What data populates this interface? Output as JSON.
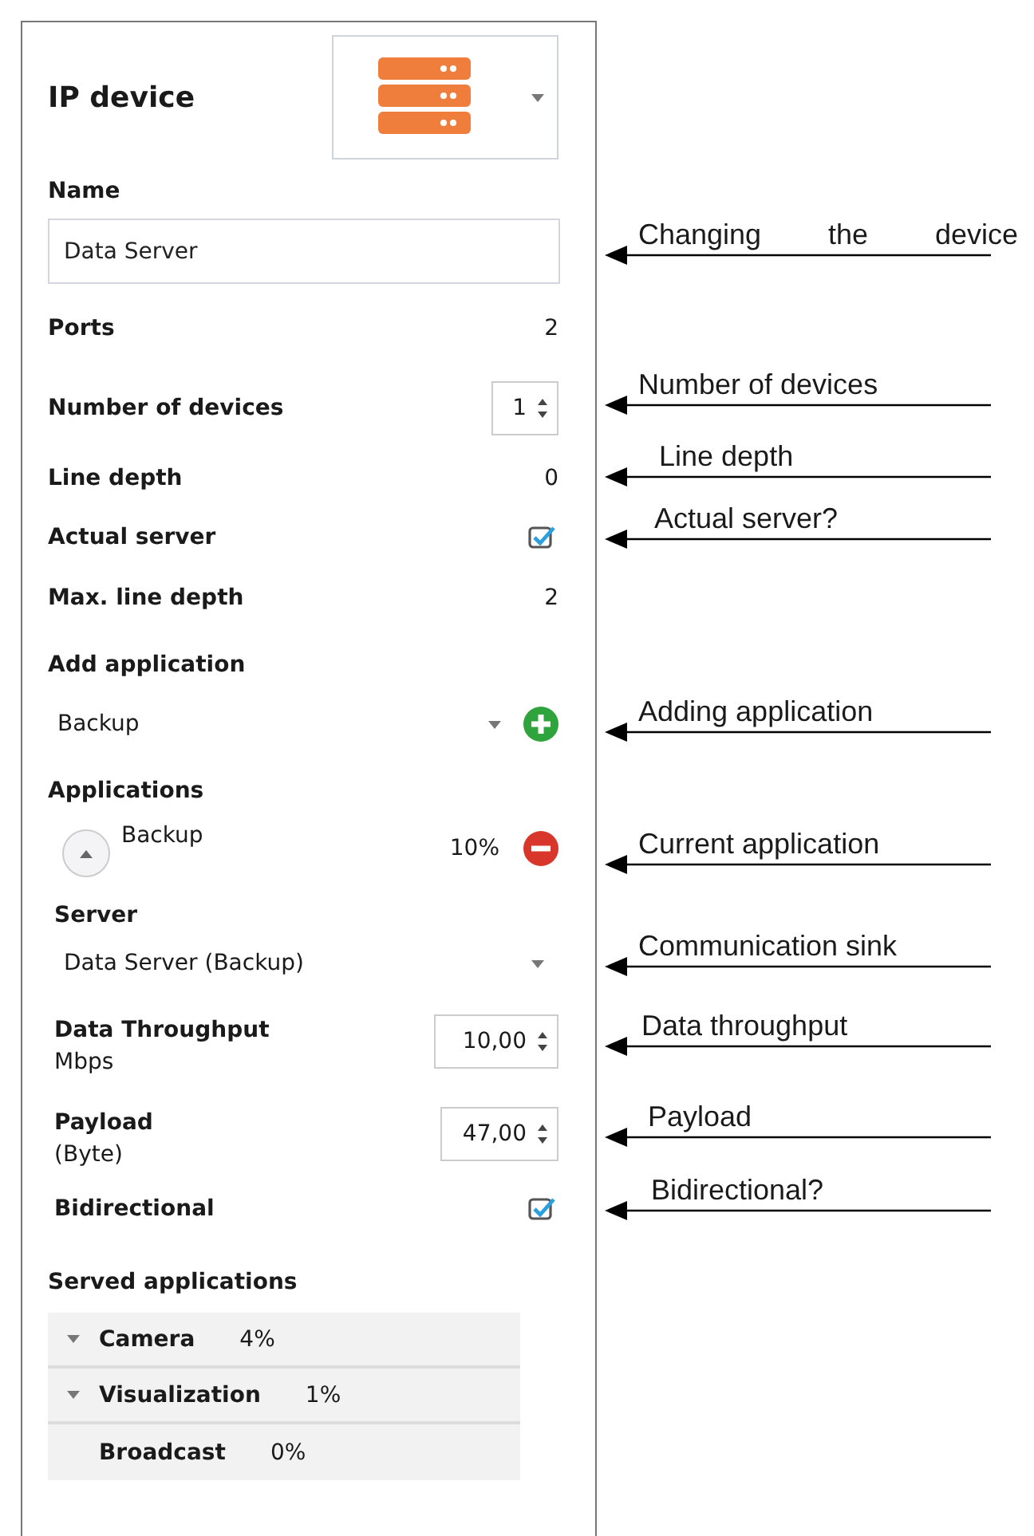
{
  "panel": {
    "title": "IP device",
    "name": {
      "label": "Name",
      "value": "Data Server"
    },
    "properties": [
      {
        "kind": "value",
        "label": "Ports",
        "value": "2"
      },
      {
        "kind": "spinner",
        "label": "Number of devices",
        "value": "1"
      },
      {
        "kind": "value",
        "label": "Line depth",
        "value": "0"
      },
      {
        "kind": "checkbox",
        "label": "Actual server",
        "checked": true
      },
      {
        "kind": "value",
        "label": "Max. line depth",
        "value": "2"
      }
    ],
    "add_application": {
      "label": "Add application",
      "value": "Backup"
    },
    "applications": {
      "label": "Applications",
      "items": [
        {
          "name": "Backup",
          "share": "10%",
          "expanded": true
        }
      ]
    },
    "server": {
      "label": "Server",
      "value": "Data Server (Backup)"
    },
    "throughput": {
      "label": "Data Throughput",
      "unit": "Mbps",
      "value": "10,00"
    },
    "payload": {
      "label": "Payload",
      "unit": "(Byte)",
      "value": "47,00"
    },
    "bidirectional": {
      "label": "Bidirectional",
      "checked": true
    },
    "served_applications": {
      "label": "Served applications",
      "items": [
        {
          "name": "Camera",
          "share": "4%",
          "expandable": true
        },
        {
          "name": "Visualization",
          "share": "1%",
          "expandable": true
        },
        {
          "name": "Broadcast",
          "share": "0%",
          "expandable": false
        }
      ]
    }
  },
  "annotations": [
    {
      "text": "Changing the device"
    },
    {
      "text": "Number of devices"
    },
    {
      "text": "Line depth"
    },
    {
      "text": "Actual server?"
    },
    {
      "text": "Adding application"
    },
    {
      "text": "Current application"
    },
    {
      "text": "Communication sink"
    },
    {
      "text": "Data throughput"
    },
    {
      "text": "Payload"
    },
    {
      "text": "Bidirectional?"
    }
  ]
}
